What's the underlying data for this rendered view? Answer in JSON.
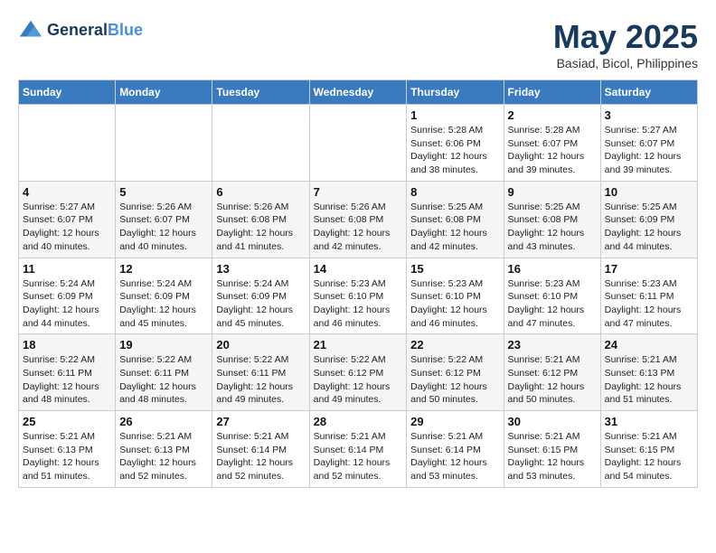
{
  "logo": {
    "line1": "General",
    "line2": "Blue"
  },
  "title": "May 2025",
  "location": "Basiad, Bicol, Philippines",
  "weekdays": [
    "Sunday",
    "Monday",
    "Tuesday",
    "Wednesday",
    "Thursday",
    "Friday",
    "Saturday"
  ],
  "weeks": [
    [
      {
        "day": "",
        "info": ""
      },
      {
        "day": "",
        "info": ""
      },
      {
        "day": "",
        "info": ""
      },
      {
        "day": "",
        "info": ""
      },
      {
        "day": "1",
        "info": "Sunrise: 5:28 AM\nSunset: 6:06 PM\nDaylight: 12 hours\nand 38 minutes."
      },
      {
        "day": "2",
        "info": "Sunrise: 5:28 AM\nSunset: 6:07 PM\nDaylight: 12 hours\nand 39 minutes."
      },
      {
        "day": "3",
        "info": "Sunrise: 5:27 AM\nSunset: 6:07 PM\nDaylight: 12 hours\nand 39 minutes."
      }
    ],
    [
      {
        "day": "4",
        "info": "Sunrise: 5:27 AM\nSunset: 6:07 PM\nDaylight: 12 hours\nand 40 minutes."
      },
      {
        "day": "5",
        "info": "Sunrise: 5:26 AM\nSunset: 6:07 PM\nDaylight: 12 hours\nand 40 minutes."
      },
      {
        "day": "6",
        "info": "Sunrise: 5:26 AM\nSunset: 6:08 PM\nDaylight: 12 hours\nand 41 minutes."
      },
      {
        "day": "7",
        "info": "Sunrise: 5:26 AM\nSunset: 6:08 PM\nDaylight: 12 hours\nand 42 minutes."
      },
      {
        "day": "8",
        "info": "Sunrise: 5:25 AM\nSunset: 6:08 PM\nDaylight: 12 hours\nand 42 minutes."
      },
      {
        "day": "9",
        "info": "Sunrise: 5:25 AM\nSunset: 6:08 PM\nDaylight: 12 hours\nand 43 minutes."
      },
      {
        "day": "10",
        "info": "Sunrise: 5:25 AM\nSunset: 6:09 PM\nDaylight: 12 hours\nand 44 minutes."
      }
    ],
    [
      {
        "day": "11",
        "info": "Sunrise: 5:24 AM\nSunset: 6:09 PM\nDaylight: 12 hours\nand 44 minutes."
      },
      {
        "day": "12",
        "info": "Sunrise: 5:24 AM\nSunset: 6:09 PM\nDaylight: 12 hours\nand 45 minutes."
      },
      {
        "day": "13",
        "info": "Sunrise: 5:24 AM\nSunset: 6:09 PM\nDaylight: 12 hours\nand 45 minutes."
      },
      {
        "day": "14",
        "info": "Sunrise: 5:23 AM\nSunset: 6:10 PM\nDaylight: 12 hours\nand 46 minutes."
      },
      {
        "day": "15",
        "info": "Sunrise: 5:23 AM\nSunset: 6:10 PM\nDaylight: 12 hours\nand 46 minutes."
      },
      {
        "day": "16",
        "info": "Sunrise: 5:23 AM\nSunset: 6:10 PM\nDaylight: 12 hours\nand 47 minutes."
      },
      {
        "day": "17",
        "info": "Sunrise: 5:23 AM\nSunset: 6:11 PM\nDaylight: 12 hours\nand 47 minutes."
      }
    ],
    [
      {
        "day": "18",
        "info": "Sunrise: 5:22 AM\nSunset: 6:11 PM\nDaylight: 12 hours\nand 48 minutes."
      },
      {
        "day": "19",
        "info": "Sunrise: 5:22 AM\nSunset: 6:11 PM\nDaylight: 12 hours\nand 48 minutes."
      },
      {
        "day": "20",
        "info": "Sunrise: 5:22 AM\nSunset: 6:11 PM\nDaylight: 12 hours\nand 49 minutes."
      },
      {
        "day": "21",
        "info": "Sunrise: 5:22 AM\nSunset: 6:12 PM\nDaylight: 12 hours\nand 49 minutes."
      },
      {
        "day": "22",
        "info": "Sunrise: 5:22 AM\nSunset: 6:12 PM\nDaylight: 12 hours\nand 50 minutes."
      },
      {
        "day": "23",
        "info": "Sunrise: 5:21 AM\nSunset: 6:12 PM\nDaylight: 12 hours\nand 50 minutes."
      },
      {
        "day": "24",
        "info": "Sunrise: 5:21 AM\nSunset: 6:13 PM\nDaylight: 12 hours\nand 51 minutes."
      }
    ],
    [
      {
        "day": "25",
        "info": "Sunrise: 5:21 AM\nSunset: 6:13 PM\nDaylight: 12 hours\nand 51 minutes."
      },
      {
        "day": "26",
        "info": "Sunrise: 5:21 AM\nSunset: 6:13 PM\nDaylight: 12 hours\nand 52 minutes."
      },
      {
        "day": "27",
        "info": "Sunrise: 5:21 AM\nSunset: 6:14 PM\nDaylight: 12 hours\nand 52 minutes."
      },
      {
        "day": "28",
        "info": "Sunrise: 5:21 AM\nSunset: 6:14 PM\nDaylight: 12 hours\nand 52 minutes."
      },
      {
        "day": "29",
        "info": "Sunrise: 5:21 AM\nSunset: 6:14 PM\nDaylight: 12 hours\nand 53 minutes."
      },
      {
        "day": "30",
        "info": "Sunrise: 5:21 AM\nSunset: 6:15 PM\nDaylight: 12 hours\nand 53 minutes."
      },
      {
        "day": "31",
        "info": "Sunrise: 5:21 AM\nSunset: 6:15 PM\nDaylight: 12 hours\nand 54 minutes."
      }
    ]
  ]
}
